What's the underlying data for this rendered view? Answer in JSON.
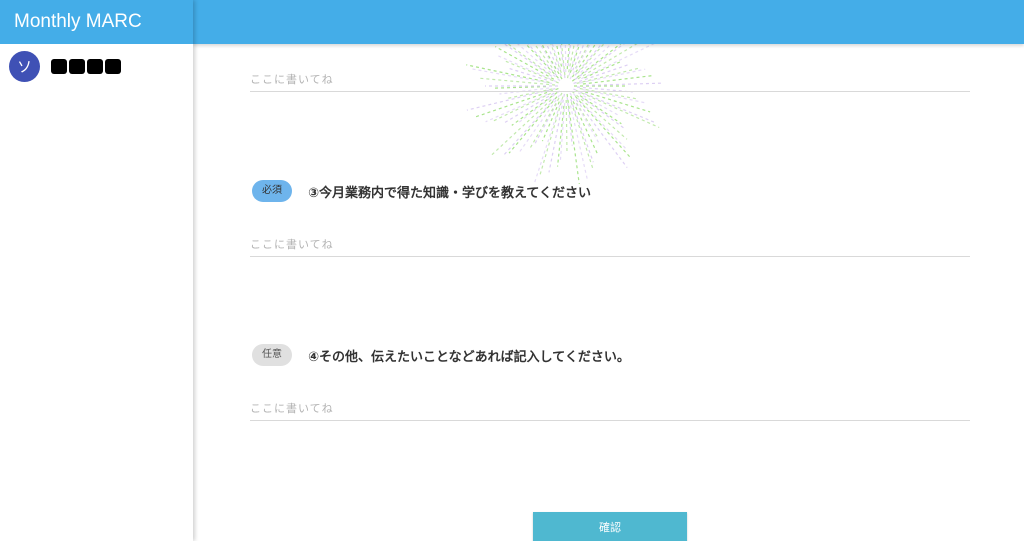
{
  "app": {
    "title": "Monthly MARC"
  },
  "user": {
    "avatar_initial": "ソ",
    "name": "████"
  },
  "colors": {
    "header": "#44ADE8",
    "avatar": "#3F51B5",
    "required_badge": "#6EB4EC",
    "optional_badge": "#E0E0E0",
    "confirm_button": "#4FB8D0"
  },
  "form": {
    "placeholder": "ここに書いてね",
    "first_field": {
      "value": "",
      "placeholder": "ここに書いてね"
    },
    "questions": [
      {
        "badge": "必須",
        "text": "③今月業務内で得た知識・学びを教えてください",
        "value": "",
        "placeholder": "ここに書いてね"
      },
      {
        "badge": "任意",
        "text": "④その他、伝えたいことなどあれば記入してください。",
        "value": "",
        "placeholder": "ここに書いてね"
      }
    ],
    "confirm_label": "確認"
  }
}
